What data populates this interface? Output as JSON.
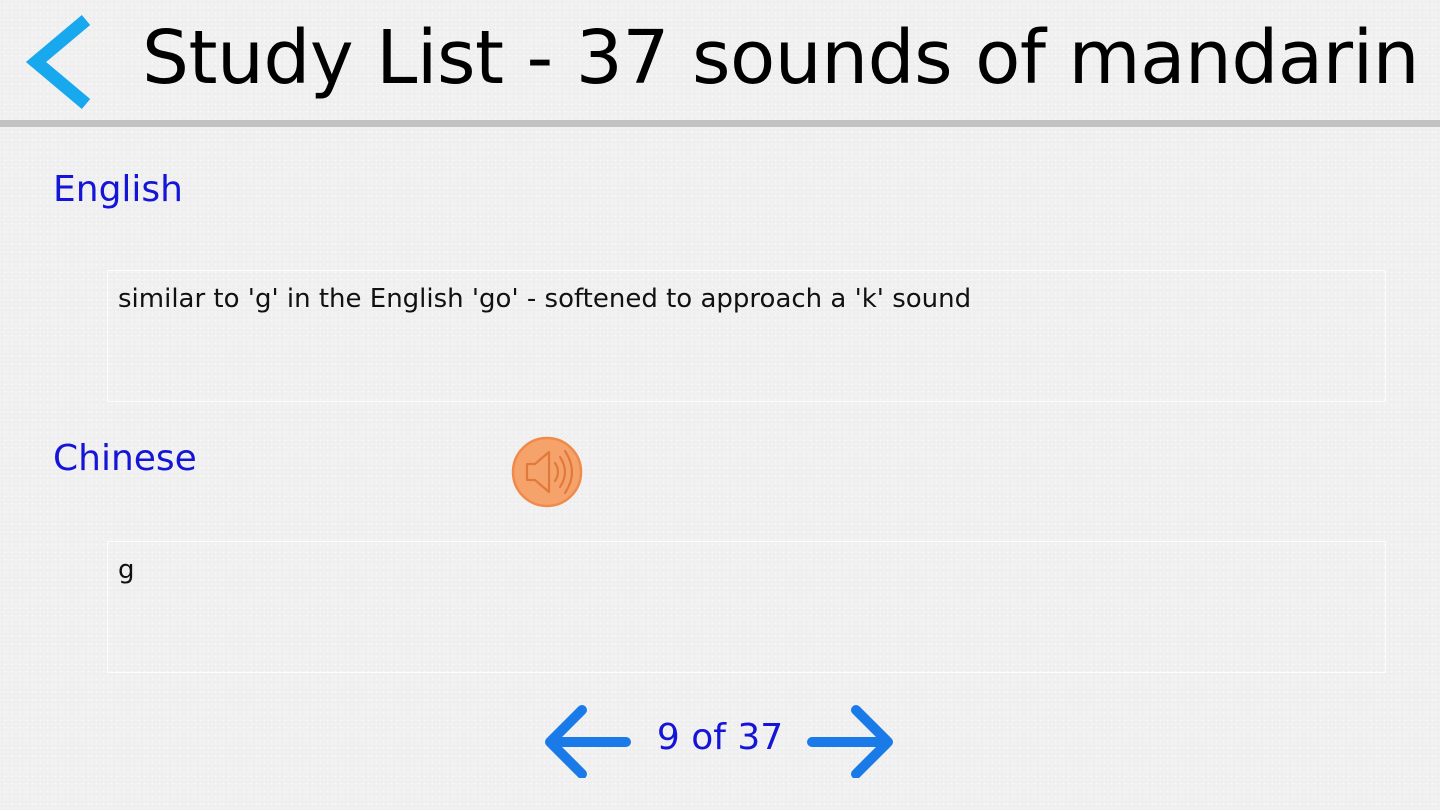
{
  "header": {
    "title": "Study List - 37 sounds of mandarin"
  },
  "sections": {
    "english": {
      "label": "English",
      "text": "similar to 'g' in the English 'go' - softened to approach a 'k' sound"
    },
    "chinese": {
      "label": "Chinese",
      "text": "g"
    }
  },
  "navigation": {
    "counter": "9 of 37",
    "current": 9,
    "total": 37
  },
  "icons": {
    "back": "chevron-left-icon",
    "sound": "speaker-icon",
    "prev": "arrow-left-icon",
    "next": "arrow-right-icon"
  },
  "colors": {
    "accent_blue": "#1515d8",
    "back_chevron": "#18a8ee",
    "nav_arrow": "#1a7be8",
    "sound_button": "#f6a36b",
    "header_rule": "#c2c2c2"
  }
}
